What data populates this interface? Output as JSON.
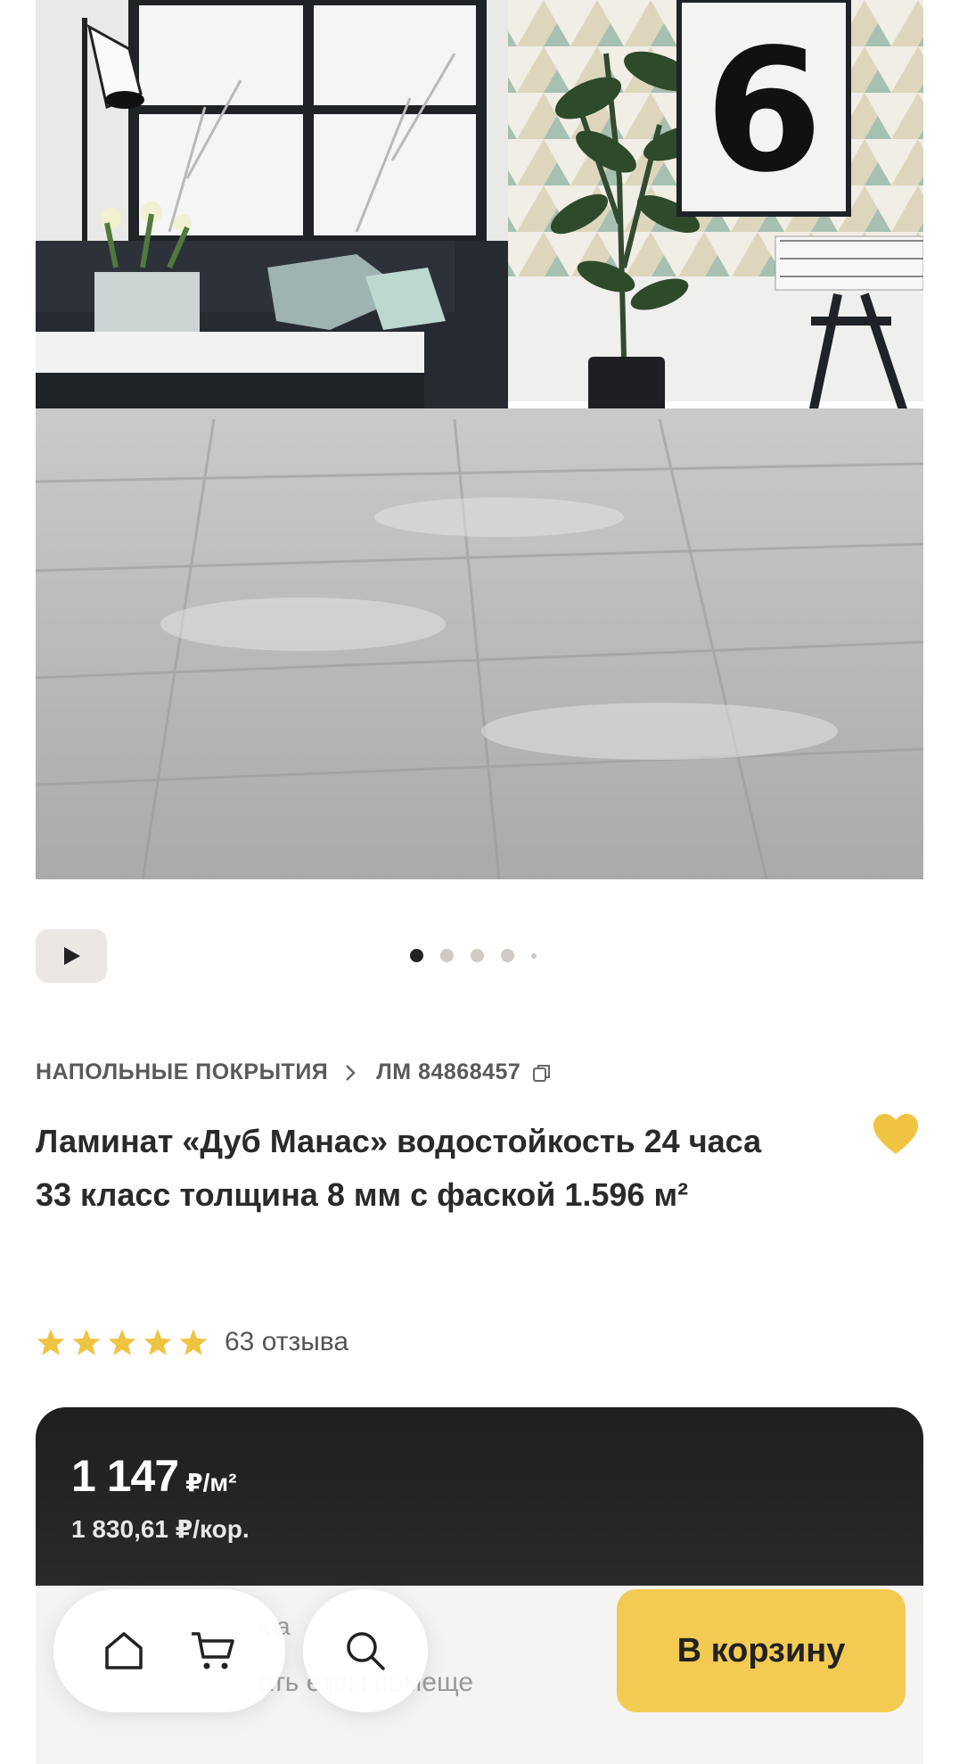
{
  "gallery": {
    "video_button": "play-icon",
    "dots_count": 5,
    "active_dot": 0
  },
  "breadcrumb": {
    "category": "НАПОЛЬНЫЕ ПОКРЫТИЯ",
    "article": "ЛМ 84868457"
  },
  "product": {
    "title": "Ламинат «Дуб Манас» водостойкость 24 часа 33 класс толщина 8 мм с фаской 1.596 м²",
    "rating": 5,
    "reviews": "63 отзыва"
  },
  "price": {
    "main": "1 147",
    "main_unit": "₽/м²",
    "per_box": "1 830,61 ₽/кор."
  },
  "card": {
    "hint_line1": "к         а",
    "hint_line2": "ать        етры помеще"
  },
  "bottom_bar": {
    "cart_label": "В корзину"
  },
  "colors": {
    "accent": "#f3cb53",
    "star": "#f0c443",
    "heart": "#f0c443",
    "price_card": "#1f1f20"
  }
}
